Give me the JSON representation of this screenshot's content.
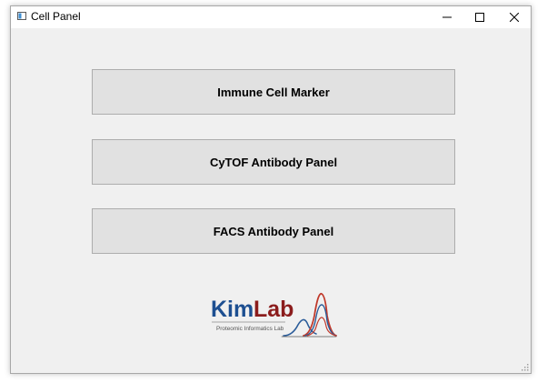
{
  "window": {
    "title": "Cell Panel",
    "icon": "app-window-icon",
    "controls": {
      "minimize": "minimize-icon",
      "maximize": "maximize-icon",
      "close": "close-icon"
    }
  },
  "buttons": [
    {
      "label": "Immune Cell Marker"
    },
    {
      "label": "CyTOF Antibody Panel"
    },
    {
      "label": "FACS Antibody Panel"
    }
  ],
  "logo": {
    "name_part1": "Kim",
    "name_part2": "Lab",
    "tagline": "Proteomic Informatics Lab",
    "colors": {
      "kim": "#1d4f91",
      "lab": "#8b1c1c",
      "peak_red": "#c0392b",
      "peak_blue": "#2c5d9a"
    }
  }
}
